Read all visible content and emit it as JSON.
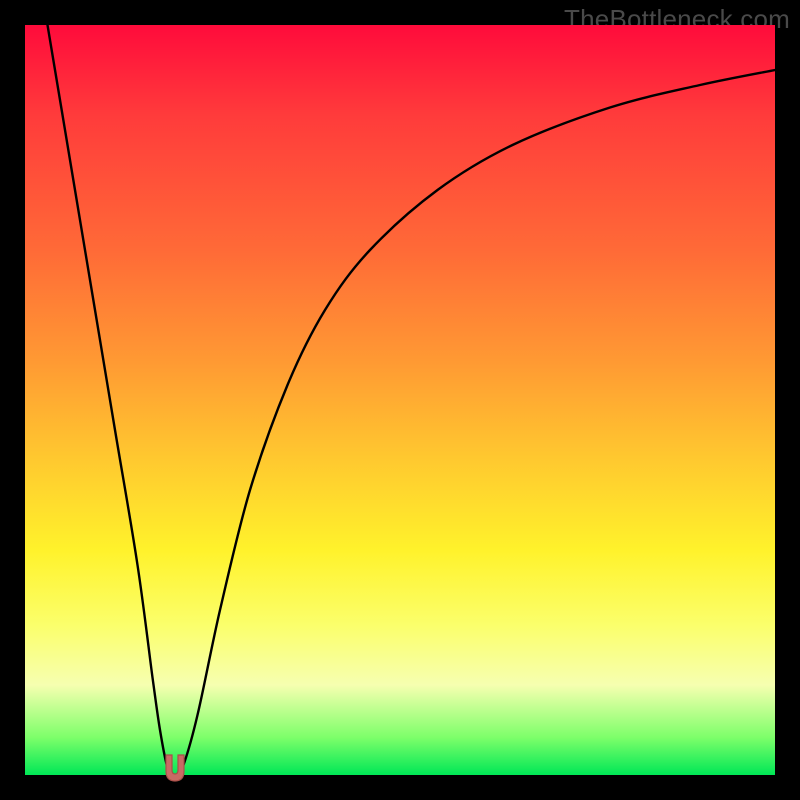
{
  "watermark": "TheBottleneck.com",
  "colors": {
    "curve": "#000000",
    "marker_fill": "#c96a64",
    "marker_stroke": "#a94f49",
    "frame": "#000000"
  },
  "chart_data": {
    "type": "line",
    "title": "",
    "xlabel": "",
    "ylabel": "",
    "xlim": [
      0,
      100
    ],
    "ylim": [
      0,
      100
    ],
    "grid": false,
    "legend": false,
    "series": [
      {
        "name": "bottleneck-curve",
        "x": [
          3,
          6,
          9,
          12,
          15,
          17,
          18,
          19,
          20,
          21,
          23,
          26,
          30,
          35,
          40,
          46,
          55,
          65,
          78,
          90,
          100
        ],
        "y": [
          100,
          82,
          64,
          46,
          28,
          13,
          6,
          1,
          0,
          1,
          8,
          22,
          38,
          52,
          62,
          70,
          78,
          84,
          89,
          92,
          94
        ]
      }
    ],
    "marker": {
      "x": 20,
      "y": 0.5,
      "shape": "u"
    }
  }
}
